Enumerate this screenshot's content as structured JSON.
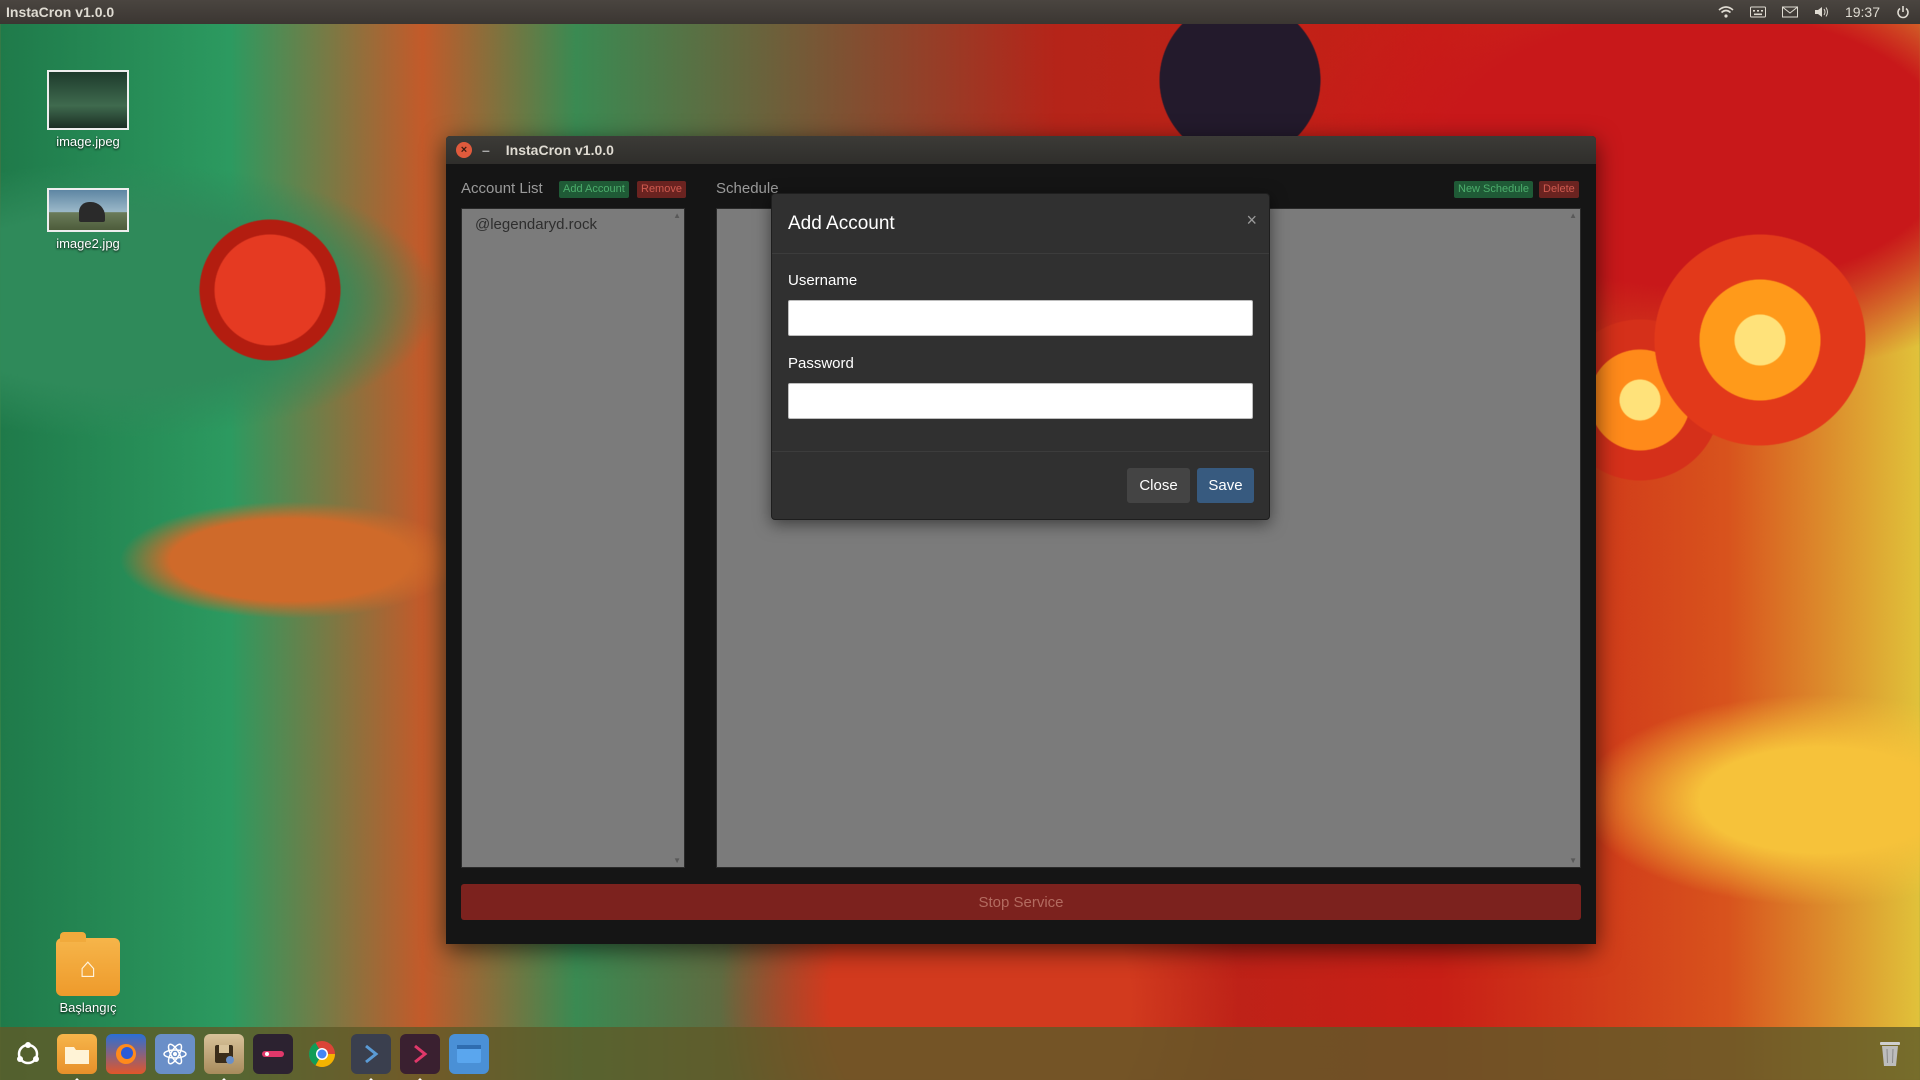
{
  "top_panel": {
    "app_title": "InstaCron v1.0.0",
    "time": "19:37",
    "icons": [
      "wifi-icon",
      "keyboard-icon",
      "mail-icon",
      "volume-icon",
      "power-icon"
    ]
  },
  "desktop": {
    "icons": [
      {
        "label": "image.jpeg"
      },
      {
        "label": "image2.jpg"
      },
      {
        "label": "Başlangıç"
      }
    ]
  },
  "launcher": {
    "items": [
      "ubuntu-logo-icon",
      "files-icon",
      "firefox-icon",
      "atom-icon",
      "system-tools-icon",
      "app-icon",
      "chrome-icon",
      "code-icon",
      "terminal-icon",
      "window-icon"
    ],
    "trash_icon": "trash-icon"
  },
  "window": {
    "title": "InstaCron v1.0.0",
    "close_glyph": "×",
    "minimize_glyph": "–",
    "account_list": {
      "label": "Account List",
      "add_button": "Add Account",
      "remove_button": "Remove",
      "items": [
        "@legendaryd.rock"
      ]
    },
    "schedule": {
      "label": "Schedule",
      "new_button": "New Schedule",
      "delete_button": "Delete"
    },
    "stop_button": "Stop Service"
  },
  "modal": {
    "title": "Add Account",
    "close_glyph": "×",
    "username_label": "Username",
    "username_value": "",
    "password_label": "Password",
    "password_value": "",
    "close_button": "Close",
    "save_button": "Save"
  },
  "colors": {
    "modal_bg": "#303030",
    "save_button": "#375a7f",
    "close_button": "#444444",
    "stop_button": "#7c221e",
    "add_account_button": "#1f5a36",
    "remove_button": "#6a2320",
    "list_bg": "#7b7b7b"
  }
}
